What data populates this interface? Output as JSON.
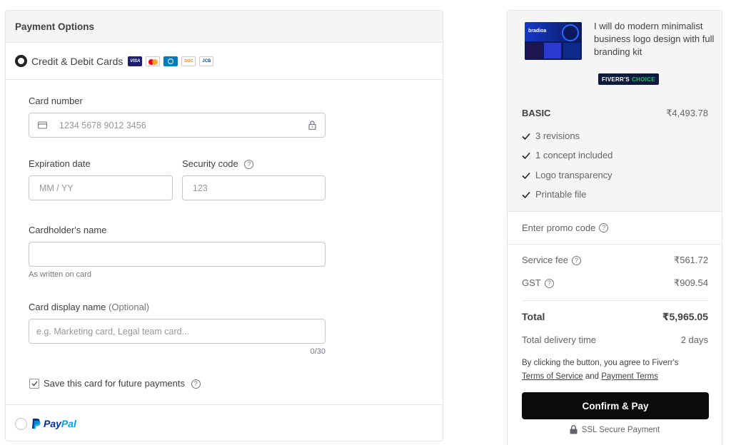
{
  "payment": {
    "header": "Payment Options",
    "card_method_label": "Credit & Debit Cards",
    "card_brands": [
      "VISA",
      "mastercard",
      "diners",
      "DISCOVER",
      "JCB"
    ],
    "card_number": {
      "label": "Card number",
      "placeholder": "1234 5678 9012 3456",
      "value": ""
    },
    "expiration": {
      "label": "Expiration date",
      "placeholder": "MM / YY",
      "value": ""
    },
    "security": {
      "label": "Security code",
      "placeholder": "123",
      "value": ""
    },
    "holder": {
      "label": "Cardholder's name",
      "hint": "As written on card",
      "value": ""
    },
    "display_name": {
      "label": "Card display name",
      "optional": "(Optional)",
      "placeholder": "e.g. Marketing card, Legal team card...",
      "counter": "0/30",
      "value": ""
    },
    "save_card": {
      "label": "Save this card for future payments",
      "checked": true
    },
    "paypal": {
      "label_pay": "Pay",
      "label_pal": "Pal",
      "selected": false
    }
  },
  "summary": {
    "thumb_brand": "bradioa",
    "gig_title": "I will do modern minimalist business logo design with full branding kit",
    "badge": {
      "brand": "FIVERR'S",
      "word": "CHOICE"
    },
    "package": {
      "name": "BASIC",
      "price": "₹4,493.78"
    },
    "features": [
      "3 revisions",
      "1 concept included",
      "Logo transparency",
      "Printable file"
    ],
    "promo_label": "Enter promo code",
    "service_fee": {
      "label": "Service fee",
      "value": "₹561.72"
    },
    "gst": {
      "label": "GST",
      "value": "₹909.54"
    },
    "total": {
      "label": "Total",
      "value": "₹5,965.05"
    },
    "delivery": {
      "label": "Total delivery time",
      "value": "2 days"
    },
    "terms_prefix": "By clicking the button, you agree to Fiverr's",
    "terms_link": "Terms of Service",
    "terms_and": "and",
    "payment_terms_link": "Payment Terms",
    "confirm_label": "Confirm & Pay",
    "ssl_label": "SSL Secure Payment"
  },
  "colors": {
    "accent": "#1dbf73",
    "button": "#0b0b0b",
    "text": "#404145"
  },
  "icons": {
    "card": "credit-card-icon",
    "lock": "lock-icon",
    "help": "question-circle-icon",
    "check": "checkmark-icon"
  }
}
